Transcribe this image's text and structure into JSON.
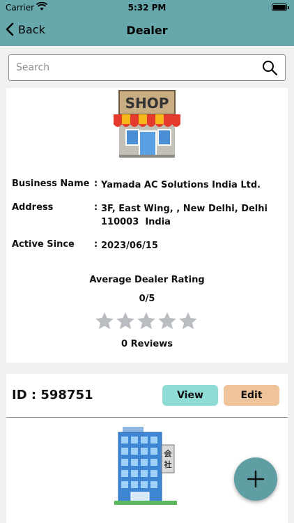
{
  "status_bar": {
    "carrier": "Carrier",
    "time": "5:32 PM"
  },
  "nav": {
    "back_label": "Back",
    "title": "Dealer"
  },
  "search": {
    "placeholder": "Search",
    "value": ""
  },
  "dealer_card": {
    "image": "shop-storefront",
    "image_text": "SHOP",
    "fields": [
      {
        "label": "Business Name",
        "separator": ":",
        "value": "Yamada AC Solutions India Ltd."
      },
      {
        "label": "Address",
        "separator": ":",
        "value_line1": "3F, East Wing, , New Delhi, Delhi",
        "value_line2": "110003  India"
      },
      {
        "label": "Active Since",
        "separator": ":",
        "value": "2023/06/15"
      }
    ],
    "rating": {
      "title": "Average Dealer Rating",
      "score_text": "0/5",
      "stars_filled": 0,
      "stars_total": 5,
      "reviews_text": "0 Reviews"
    }
  },
  "second_card": {
    "id_text": "ID : 598751",
    "view_label": "View",
    "edit_label": "Edit",
    "image": "office-building",
    "image_text": "会社"
  },
  "fab": {
    "icon": "plus-icon"
  },
  "colors": {
    "header": "#67a8ad",
    "view_button": "#8fdcd7",
    "edit_button": "#f0c49a",
    "fab": "#5f9ea3",
    "star_empty": "#b9bcc0"
  }
}
